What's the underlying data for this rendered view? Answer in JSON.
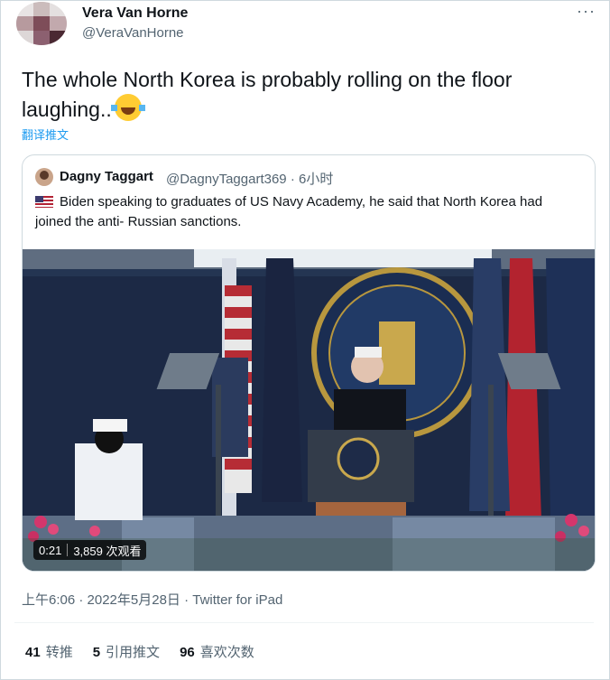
{
  "tweet": {
    "author_name": "Vera Van Horne",
    "author_handle": "@VeraVanHorne",
    "more_label": "···",
    "text": "The whole North Korea is probably rolling on the floor laughing..",
    "emoji": "face-with-tears-of-joy",
    "translate_label": "翻译推文",
    "timestamp": "上午6:06 · 2022年5月28日 · Twitter for iPad"
  },
  "quoted_tweet": {
    "author_name": "Dagny Taggart",
    "author_handle": "@DagnyTaggart369",
    "time_ago": "6小时",
    "text": "Biden speaking to graduates of US Navy Academy, he said that North Korea had joined the anti- Russian sanctions.",
    "flag": "us-flag-emoji"
  },
  "video": {
    "duration": "0:21",
    "views": "3,859 次观看"
  },
  "stats": [
    {
      "count": "41",
      "label": "转推"
    },
    {
      "count": "5",
      "label": "引用推文"
    },
    {
      "count": "96",
      "label": "喜欢次数"
    }
  ],
  "colors": {
    "link": "#1d9bf0",
    "secondary_text": "#536471",
    "border": "#cfd9de"
  }
}
